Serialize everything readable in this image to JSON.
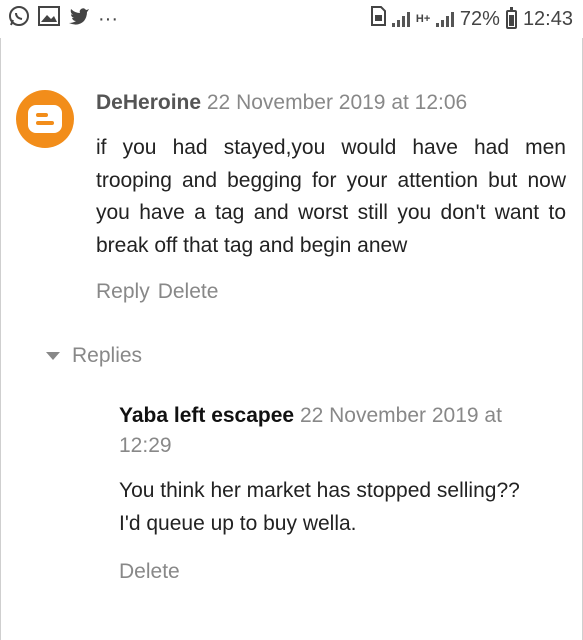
{
  "status_bar": {
    "left_icons": [
      "whatsapp-icon",
      "image-icon",
      "twitter-icon"
    ],
    "more": "···",
    "network": "H+",
    "battery": "72%",
    "time": "12:43"
  },
  "comment": {
    "avatar_icon": "blogger-icon",
    "author": "DeHeroine",
    "date": "22 November 2019 at 12:06",
    "text": "if you had stayed,you would have had men trooping and begging for your attention but now you have a tag and worst still you don't want to break off that tag and begin anew",
    "actions": {
      "reply": "Reply",
      "delete": "Delete"
    }
  },
  "replies": {
    "toggle_label": "Replies",
    "items": [
      {
        "author": "Yaba left escapee",
        "date": "22 November 2019 at 12:29",
        "lines": [
          "You think her market has stopped selling??",
          "I'd queue up to buy wella."
        ],
        "actions": {
          "delete": "Delete"
        }
      }
    ]
  },
  "colors": {
    "blogger_orange": "#f28d1a",
    "meta_gray": "#888888"
  }
}
